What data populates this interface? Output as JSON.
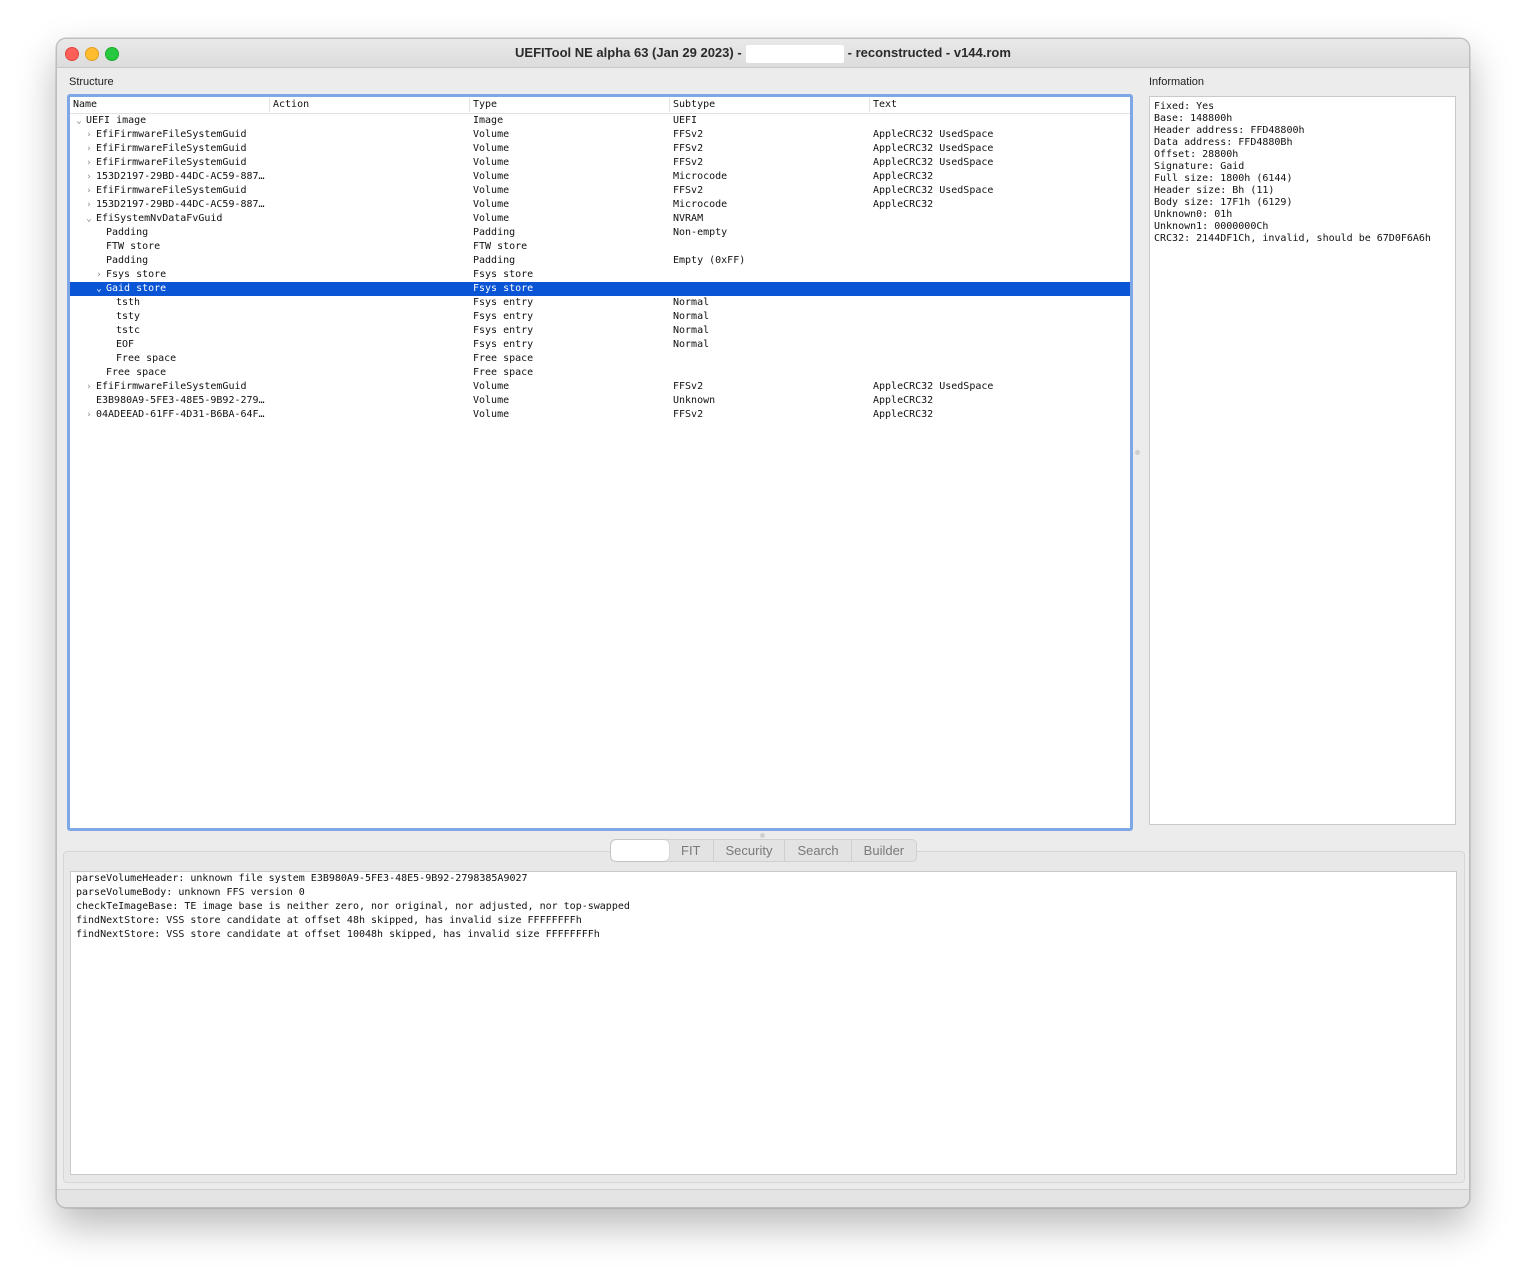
{
  "window": {
    "title_prefix": "UEFITool NE alpha 63 (Jan 29 2023) -",
    "title_suffix": "- reconstructed - v144.rom"
  },
  "structure": {
    "label": "Structure",
    "columns": [
      "Name",
      "Action",
      "Type",
      "Subtype",
      "Text"
    ],
    "rows": [
      {
        "name": "UEFI image",
        "level": 0,
        "arrow": "expanded",
        "action": "",
        "type": "Image",
        "subtype": "UEFI",
        "text": ""
      },
      {
        "name": "EfiFirmwareFileSystemGuid",
        "level": 1,
        "arrow": "collapsed",
        "action": "",
        "type": "Volume",
        "subtype": "FFSv2",
        "text": "AppleCRC32 UsedSpace"
      },
      {
        "name": "EfiFirmwareFileSystemGuid",
        "level": 1,
        "arrow": "collapsed",
        "action": "",
        "type": "Volume",
        "subtype": "FFSv2",
        "text": "AppleCRC32 UsedSpace"
      },
      {
        "name": "EfiFirmwareFileSystemGuid",
        "level": 1,
        "arrow": "collapsed",
        "action": "",
        "type": "Volume",
        "subtype": "FFSv2",
        "text": "AppleCRC32 UsedSpace"
      },
      {
        "name": "153D2197-29BD-44DC-AC59-887…",
        "level": 1,
        "arrow": "collapsed",
        "action": "",
        "type": "Volume",
        "subtype": "Microcode",
        "text": "AppleCRC32"
      },
      {
        "name": "EfiFirmwareFileSystemGuid",
        "level": 1,
        "arrow": "collapsed",
        "action": "",
        "type": "Volume",
        "subtype": "FFSv2",
        "text": "AppleCRC32 UsedSpace"
      },
      {
        "name": "153D2197-29BD-44DC-AC59-887…",
        "level": 1,
        "arrow": "collapsed",
        "action": "",
        "type": "Volume",
        "subtype": "Microcode",
        "text": "AppleCRC32"
      },
      {
        "name": "EfiSystemNvDataFvGuid",
        "level": 1,
        "arrow": "expanded",
        "action": "",
        "type": "Volume",
        "subtype": "NVRAM",
        "text": ""
      },
      {
        "name": "Padding",
        "level": 2,
        "arrow": "none",
        "action": "",
        "type": "Padding",
        "subtype": "Non-empty",
        "text": ""
      },
      {
        "name": "FTW store",
        "level": 2,
        "arrow": "none",
        "action": "",
        "type": "FTW store",
        "subtype": "",
        "text": ""
      },
      {
        "name": "Padding",
        "level": 2,
        "arrow": "none",
        "action": "",
        "type": "Padding",
        "subtype": "Empty (0xFF)",
        "text": ""
      },
      {
        "name": "Fsys store",
        "level": 2,
        "arrow": "collapsed",
        "action": "",
        "type": "Fsys store",
        "subtype": "",
        "text": ""
      },
      {
        "name": "Gaid store",
        "level": 2,
        "arrow": "expanded",
        "action": "",
        "type": "Fsys store",
        "subtype": "",
        "text": "",
        "selected": true
      },
      {
        "name": "tsth",
        "level": 3,
        "arrow": "none",
        "action": "",
        "type": "Fsys entry",
        "subtype": "Normal",
        "text": ""
      },
      {
        "name": "tsty",
        "level": 3,
        "arrow": "none",
        "action": "",
        "type": "Fsys entry",
        "subtype": "Normal",
        "text": ""
      },
      {
        "name": "tstc",
        "level": 3,
        "arrow": "none",
        "action": "",
        "type": "Fsys entry",
        "subtype": "Normal",
        "text": ""
      },
      {
        "name": "EOF",
        "level": 3,
        "arrow": "none",
        "action": "",
        "type": "Fsys entry",
        "subtype": "Normal",
        "text": ""
      },
      {
        "name": "Free space",
        "level": 3,
        "arrow": "none",
        "action": "",
        "type": "Free space",
        "subtype": "",
        "text": ""
      },
      {
        "name": "Free space",
        "level": 2,
        "arrow": "none",
        "action": "",
        "type": "Free space",
        "subtype": "",
        "text": ""
      },
      {
        "name": "EfiFirmwareFileSystemGuid",
        "level": 1,
        "arrow": "collapsed",
        "action": "",
        "type": "Volume",
        "subtype": "FFSv2",
        "text": "AppleCRC32 UsedSpace"
      },
      {
        "name": "E3B980A9-5FE3-48E5-9B92-279…",
        "level": 1,
        "arrow": "none",
        "action": "",
        "type": "Volume",
        "subtype": "Unknown",
        "text": "AppleCRC32"
      },
      {
        "name": "04ADEEAD-61FF-4D31-B6BA-64F…",
        "level": 1,
        "arrow": "collapsed",
        "action": "",
        "type": "Volume",
        "subtype": "FFSv2",
        "text": "AppleCRC32"
      }
    ]
  },
  "information": {
    "label": "Information",
    "lines": [
      "Fixed: Yes",
      "Base: 148800h",
      "Header address: FFD48800h",
      "Data address: FFD4880Bh",
      "Offset: 28800h",
      "Signature: Gaid",
      "Full size: 1800h (6144)",
      "Header size: Bh (11)",
      "Body size: 17F1h (6129)",
      "Unknown0: 01h",
      "Unknown1: 0000000Ch",
      "CRC32: 2144DF1Ch, invalid, should be 67D0F6A6h"
    ]
  },
  "tabs": [
    "",
    "FIT",
    "Security",
    "Search",
    "Builder"
  ],
  "messages": [
    "parseVolumeHeader: unknown file system E3B980A9-5FE3-48E5-9B92-2798385A9027",
    "parseVolumeBody: unknown FFS version 0",
    "checkTeImageBase: TE image base is neither zero, nor original, nor adjusted, nor top-swapped",
    "findNextStore: VSS store candidate at offset 48h skipped, has invalid size FFFFFFFFh",
    "findNextStore: VSS store candidate at offset 10048h skipped, has invalid size FFFFFFFFh"
  ]
}
